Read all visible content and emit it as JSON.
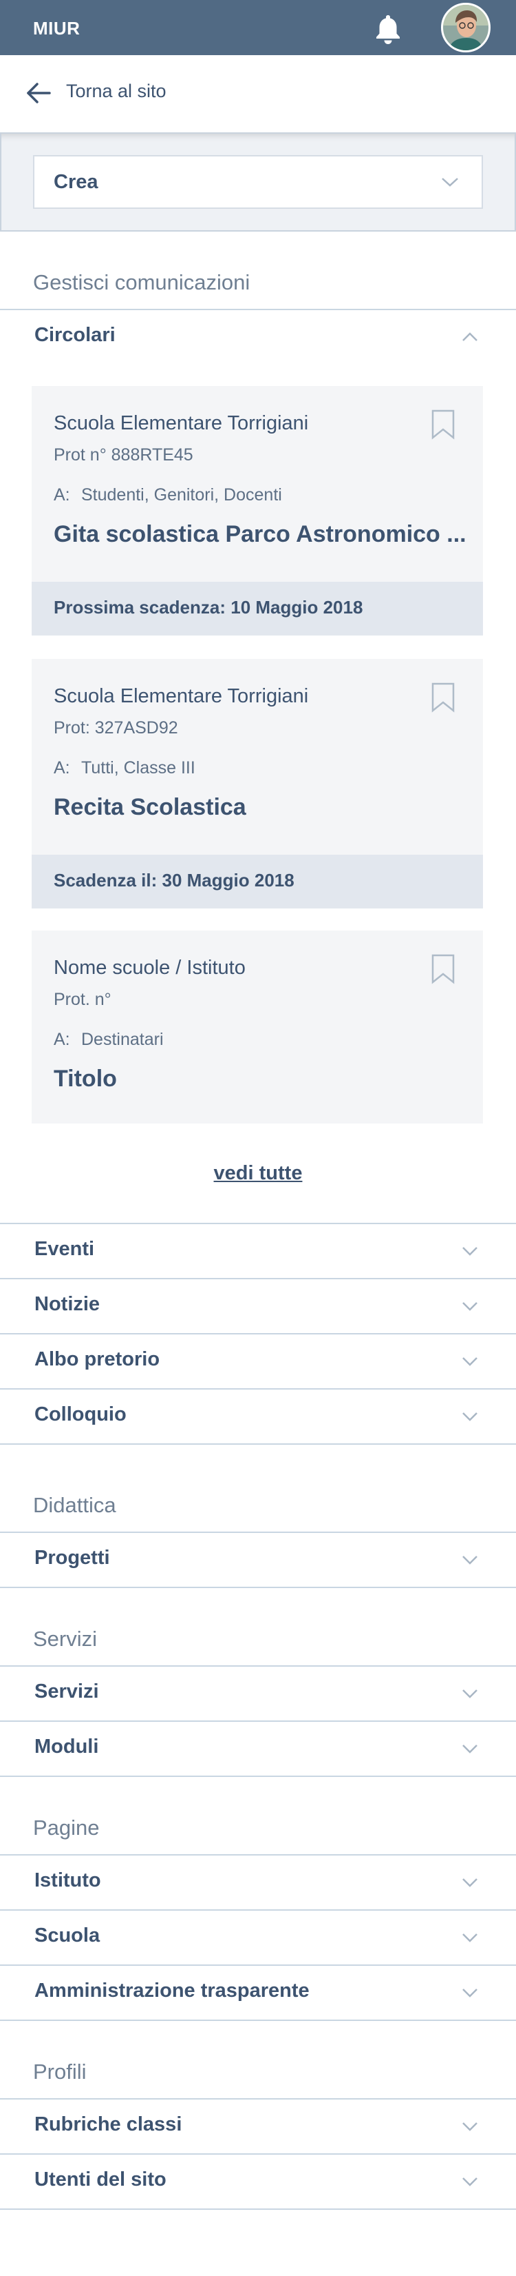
{
  "header": {
    "brand": "MIUR",
    "notification_icon": "bell-icon",
    "avatar_icon": "user-avatar"
  },
  "nav": {
    "back_label": "Torna al sito",
    "back_icon": "arrow-left-icon"
  },
  "create": {
    "label": "Crea",
    "chevron_icon": "chevron-down-icon"
  },
  "sections": {
    "manage": "Gestisci comunicazioni",
    "didactics": "Didattica",
    "services": "Servizi",
    "pages": "Pagine",
    "profiles": "Profili"
  },
  "circolari": {
    "label": "Circolari",
    "cards": [
      {
        "school": "Scuola Elementare Torrigiani",
        "prot": "Prot n° 888RTE45",
        "to_key": "A:",
        "to_val": "Studenti, Genitori, Docenti",
        "title": "Gita scolastica Parco Astronomico ...",
        "footer": "Prossima scadenza: 10 Maggio 2018"
      },
      {
        "school": "Scuola Elementare Torrigiani",
        "prot": "Prot: 327ASD92",
        "to_key": "A:",
        "to_val": "Tutti, Classe III",
        "title": "Recita Scolastica",
        "footer": "Scadenza il: 30 Maggio 2018"
      },
      {
        "school": "Nome scuole / Istituto",
        "prot": "Prot. n°",
        "to_key": "A:",
        "to_val": "Destinatari",
        "title": "Titolo"
      }
    ],
    "see_all": "vedi tutte"
  },
  "menu": {
    "eventi": "Eventi",
    "notizie": "Notizie",
    "albo": "Albo pretorio",
    "colloquio": "Colloquio",
    "progetti": "Progetti",
    "servizi": "Servizi",
    "moduli": "Moduli",
    "istituto": "Istituto",
    "scuola": "Scuola",
    "amministrazione": "Amministrazione trasparente",
    "rubriche": "Rubriche classi",
    "utenti": "Utenti del sito"
  },
  "colors": {
    "header_bg": "#516a84",
    "text": "#3d5370",
    "section_text": "#6f7f92",
    "divider": "#c9d6e2",
    "card_bg": "#f4f5f7",
    "card_footer_bg": "#e2e7ee"
  }
}
